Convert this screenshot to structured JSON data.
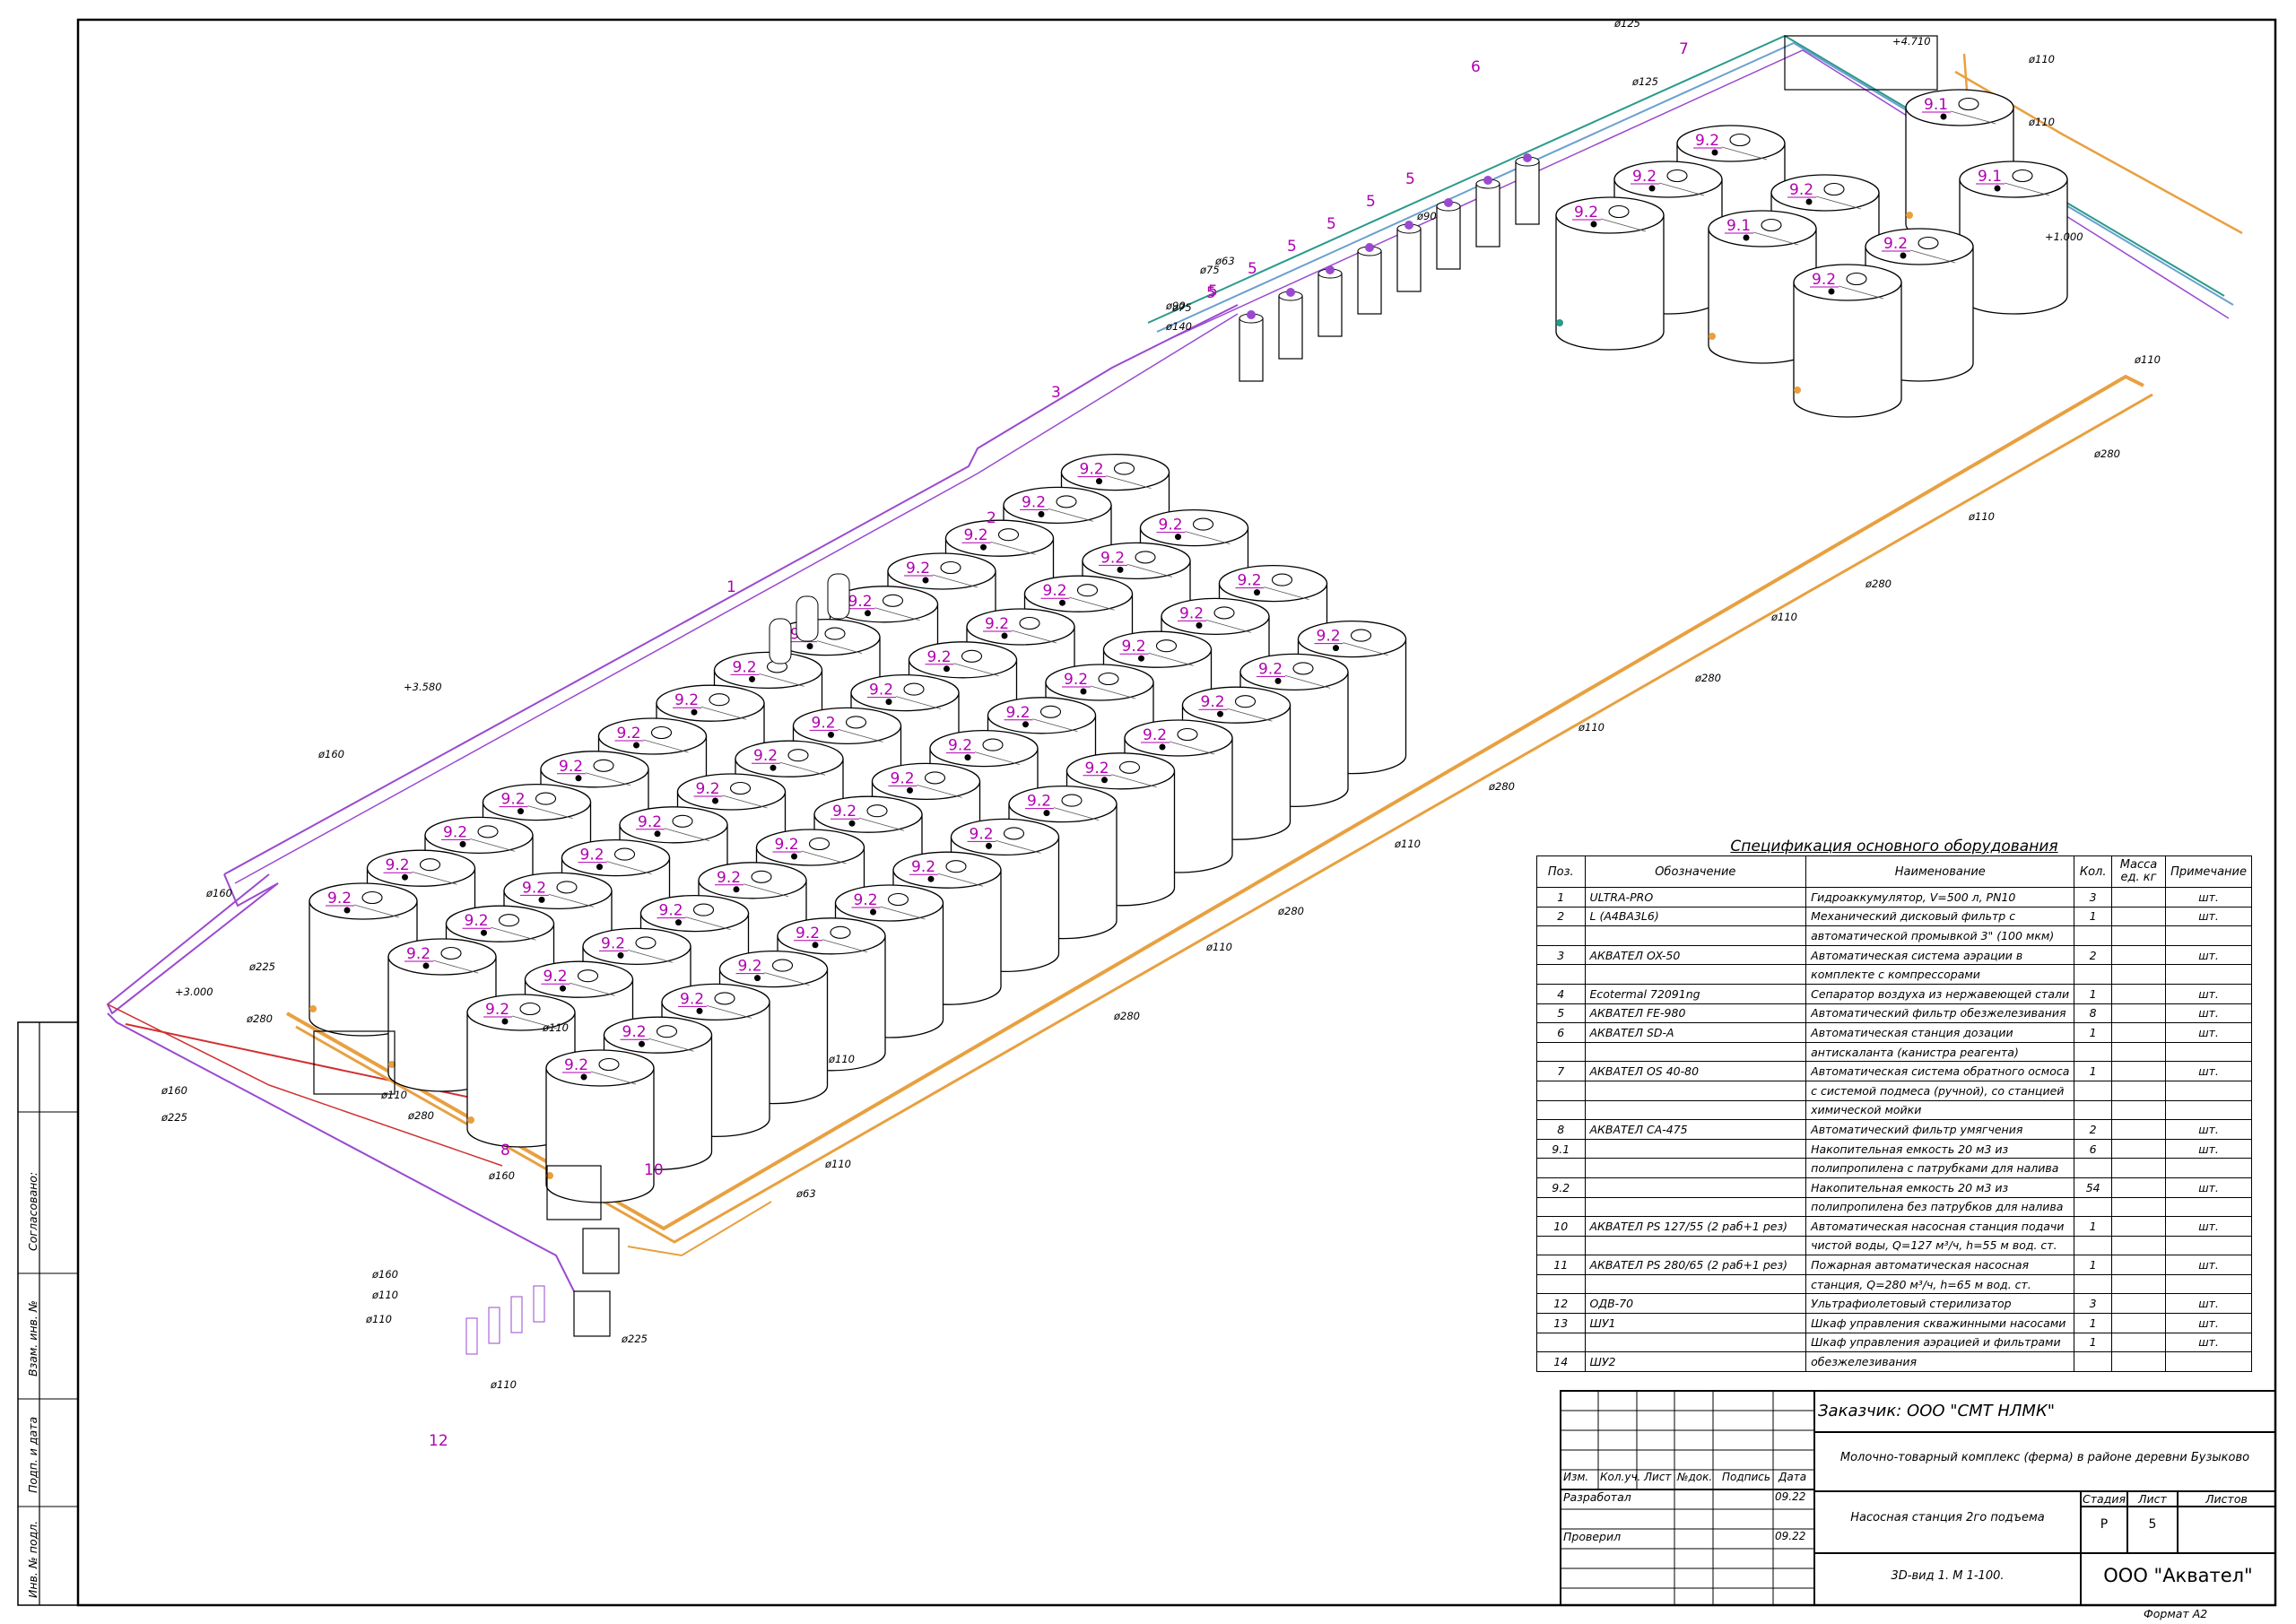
{
  "colors": {
    "tank_label": "#b000b0",
    "pipe_orange": "#e8a040",
    "pipe_violet": "#9a4ad0",
    "pipe_green": "#2a9a8a",
    "pipe_red": "#d03030"
  },
  "drawing": {
    "elevations": [
      "+3.580",
      "+3.000",
      "+4.710",
      "+1.000"
    ],
    "positions": [
      "1",
      "2",
      "3",
      "5",
      "6",
      "7",
      "8",
      "10",
      "12"
    ],
    "tank_labels": [
      "9.1",
      "9.2"
    ],
    "pipe_diameters": [
      "ø160",
      "ø225",
      "ø280",
      "ø110",
      "ø63",
      "ø75",
      "ø90",
      "ø125",
      "ø140"
    ]
  },
  "spec": {
    "title": "Спецификация основного оборудования",
    "headers": [
      "Поз.",
      "Обозначение",
      "Наименование",
      "Кол.",
      "Масса ед. кг",
      "Примечание"
    ],
    "rows": [
      [
        "1",
        "ULTRA-PRO",
        "Гидроаккумулятор, V=500 л, PN10",
        "3",
        "",
        "шт."
      ],
      [
        "2",
        "L (A4BA3L6)",
        "Механический дисковый фильтр с",
        "1",
        "",
        "шт."
      ],
      [
        "",
        "",
        "автоматической промывкой 3\" (100 мкм)",
        "",
        "",
        ""
      ],
      [
        "3",
        "АКВАТЕЛ OX-50",
        "Автоматическая система аэрации в",
        "2",
        "",
        "шт."
      ],
      [
        "",
        "",
        "комплекте с компрессорами",
        "",
        "",
        ""
      ],
      [
        "4",
        "Ecotermal 72091ng",
        "Сепаратор воздуха из нержавеющей стали",
        "1",
        "",
        "шт."
      ],
      [
        "5",
        "АКВАТЕЛ FE-980",
        "Автоматический фильтр обезжелезивания",
        "8",
        "",
        "шт."
      ],
      [
        "6",
        "АКВАТЕЛ SD-A",
        "Автоматическая станция дозации",
        "1",
        "",
        "шт."
      ],
      [
        "",
        "",
        "антискаланта (канистра реагента)",
        "",
        "",
        ""
      ],
      [
        "7",
        "АКВАТЕЛ OS 40-80",
        "Автоматическая система обратного осмоса",
        "1",
        "",
        "шт."
      ],
      [
        "",
        "",
        "с системой подмеса (ручной), со станцией",
        "",
        "",
        ""
      ],
      [
        "",
        "",
        "химической мойки",
        "",
        "",
        ""
      ],
      [
        "8",
        "АКВАТЕЛ CA-475",
        "Автоматический фильтр умягчения",
        "2",
        "",
        "шт."
      ],
      [
        "9.1",
        "",
        "Накопительная емкость 20 м3 из",
        "6",
        "",
        "шт."
      ],
      [
        "",
        "",
        "полипропилена с патрубками для налива",
        "",
        "",
        ""
      ],
      [
        "9.2",
        "",
        "Накопительная емкость 20 м3 из",
        "54",
        "",
        "шт."
      ],
      [
        "",
        "",
        "полипропилена без патрубков для налива",
        "",
        "",
        ""
      ],
      [
        "10",
        "АКВАТЕЛ PS 127/55 (2 раб+1 рез)",
        "Автоматическая насосная станция подачи",
        "1",
        "",
        "шт."
      ],
      [
        "",
        "",
        "чистой воды, Q=127 м³/ч, h=55 м вод. ст.",
        "",
        "",
        ""
      ],
      [
        "11",
        "АКВАТЕЛ PS 280/65 (2 раб+1 рез)",
        "Пожарная автоматическая насосная",
        "1",
        "",
        "шт."
      ],
      [
        "",
        "",
        "станция, Q=280 м³/ч, h=65 м вод. ст.",
        "",
        "",
        ""
      ],
      [
        "12",
        "ОДВ-70",
        "Ультрафиолетовый стерилизатор",
        "3",
        "",
        "шт."
      ],
      [
        "13",
        "ШУ1",
        "Шкаф управления скважинными насосами",
        "1",
        "",
        "шт."
      ],
      [
        "",
        "",
        "Шкаф управления аэрацией и фильтрами",
        "1",
        "",
        "шт."
      ],
      [
        "14",
        "ШУ2",
        "обезжелезивания",
        "",
        "",
        ""
      ]
    ]
  },
  "titleblock": {
    "customer": "Заказчик: ООО \"СМТ НЛМК\"",
    "project": "Молочно-товарный комплекс (ферма) в районе деревни Бузыково",
    "object": "Насосная станция 2го подъема",
    "view": "3D-вид 1. М 1-100.",
    "company": "ООО \"Аквател\"",
    "cols": [
      "Изм.",
      "Кол.уч.",
      "Лист",
      "№док.",
      "Подпись",
      "Дата"
    ],
    "developed": "Разработал",
    "checked": "Проверил",
    "date1": "09.22",
    "date2": "09.22",
    "stage_h": "Стадия",
    "sheet_h": "Лист",
    "sheets_h": "Листов",
    "stage": "Р",
    "sheet": "5",
    "sheets": "",
    "format": "Формат А2"
  },
  "side": {
    "agreed": "Согласовано:",
    "inv_replace": "Взам. инв. №",
    "sign_date": "Подп. и дата",
    "inv_orig": "Инв. № подл."
  }
}
